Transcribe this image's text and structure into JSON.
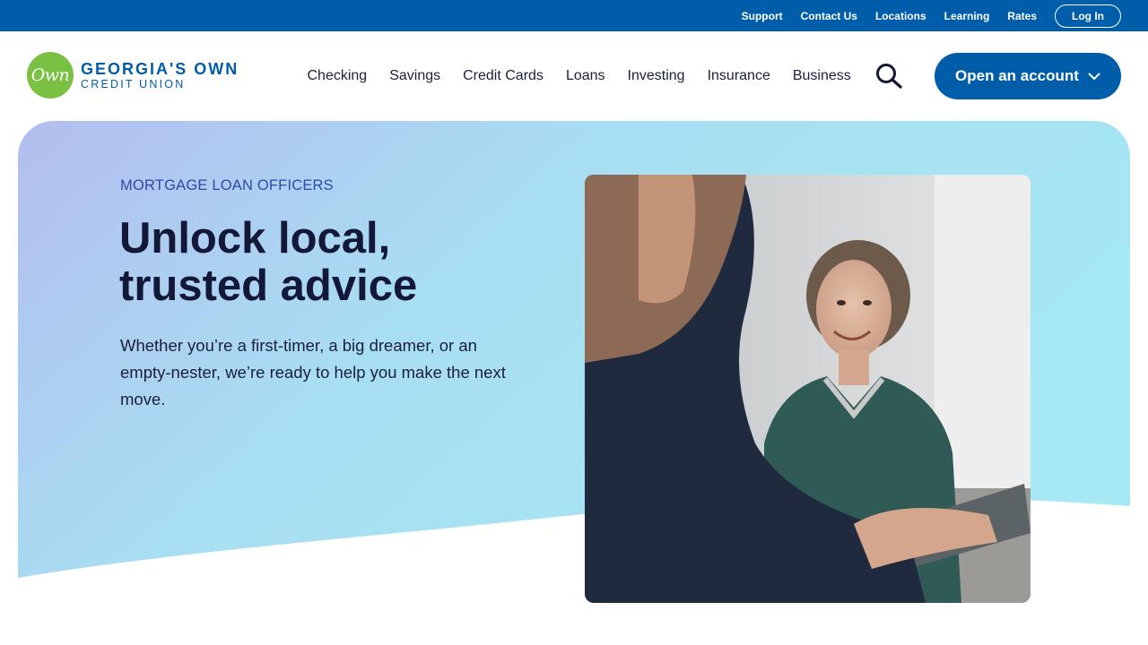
{
  "utility_bar": {
    "links": [
      "Support",
      "Contact Us",
      "Locations",
      "Learning",
      "Rates"
    ],
    "login_label": "Log In"
  },
  "logo": {
    "badge": "Own",
    "line1": "GEORGIA'S OWN",
    "line2": "CREDIT UNION"
  },
  "nav": {
    "items": [
      "Checking",
      "Savings",
      "Credit Cards",
      "Loans",
      "Investing",
      "Insurance",
      "Business"
    ],
    "search_icon": "search-icon",
    "cta_label": "Open an account"
  },
  "hero": {
    "eyebrow": "MORTGAGE LOAN OFFICERS",
    "title_line1": "Unlock local,",
    "title_line2": "trusted advice",
    "body": "Whether you’re a first-timer, a big dreamer, or an empty-nester, we’re ready to help you make the next move."
  },
  "colors": {
    "brand_blue": "#005daa",
    "brand_green": "#7ac143",
    "gradient_start": "#b4bff0",
    "gradient_end": "#a6e6f3"
  }
}
